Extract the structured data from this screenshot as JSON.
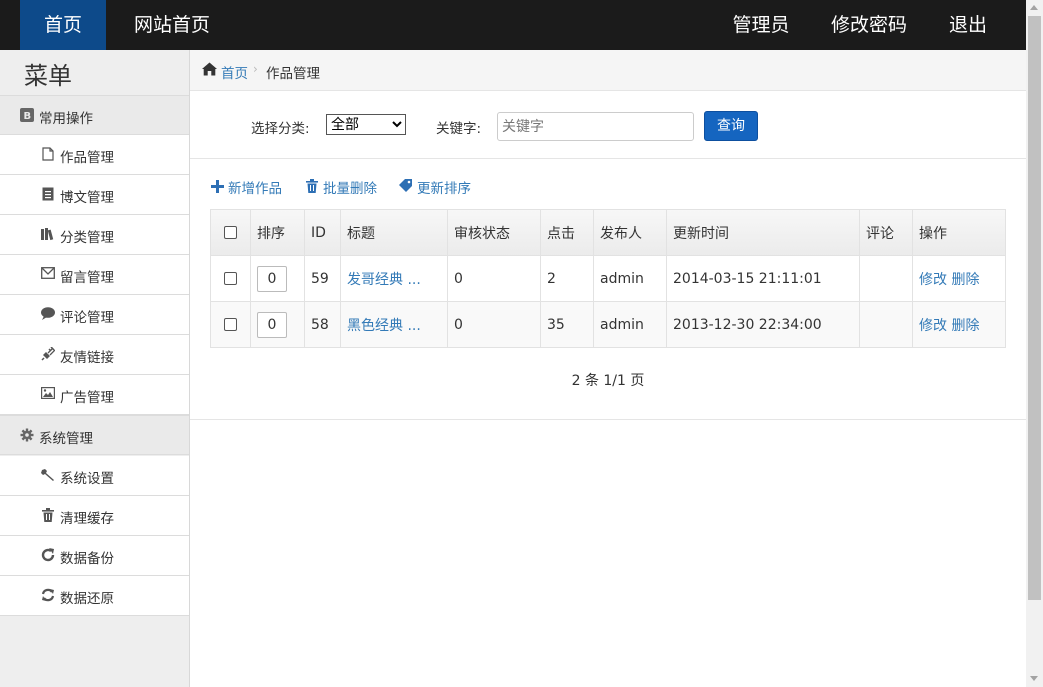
{
  "topbar": {
    "home": "首页",
    "site_home": "网站首页",
    "admin": "管理员",
    "change_password": "修改密码",
    "logout": "退出"
  },
  "sidebar": {
    "title": "菜单",
    "groups": [
      {
        "label": "常用操作",
        "icon": "bootstrap-icon"
      },
      {
        "label": "系统管理",
        "icon": "gear-icon"
      }
    ],
    "common_items": [
      {
        "label": "作品管理",
        "icon": "file-icon"
      },
      {
        "label": "博文管理",
        "icon": "list-doc-icon"
      },
      {
        "label": "分类管理",
        "icon": "books-icon"
      },
      {
        "label": "留言管理",
        "icon": "envelope-icon"
      },
      {
        "label": "评论管理",
        "icon": "comment-icon"
      },
      {
        "label": "友情链接",
        "icon": "plug-icon"
      },
      {
        "label": "广告管理",
        "icon": "picture-icon"
      }
    ],
    "system_items": [
      {
        "label": "系统设置",
        "icon": "wrench-icon"
      },
      {
        "label": "清理缓存",
        "icon": "trash-icon"
      },
      {
        "label": "数据备份",
        "icon": "refresh-icon"
      },
      {
        "label": "数据还原",
        "icon": "sync-icon"
      }
    ]
  },
  "breadcrumb": {
    "home": "首页",
    "current": "作品管理"
  },
  "search": {
    "category_label": "选择分类:",
    "category_selected": "全部",
    "keyword_label": "关键字:",
    "keyword_placeholder": "关键字",
    "query_button": "查询"
  },
  "toolbar": {
    "add": "新增作品",
    "batch_delete": "批量删除",
    "update_sort": "更新排序"
  },
  "table": {
    "headers": [
      "排序",
      "ID",
      "标题",
      "审核状态",
      "点击",
      "发布人",
      "更新时间",
      "评论",
      "操作"
    ],
    "rows": [
      {
        "sort": "0",
        "id": "59",
        "title": "发哥经典 ...",
        "status": "0",
        "clicks": "2",
        "author": "admin",
        "updated": "2014-03-15 21:11:01",
        "comments": "",
        "edit": "修改",
        "delete": "删除"
      },
      {
        "sort": "0",
        "id": "58",
        "title": "黑色经典 ...",
        "status": "0",
        "clicks": "35",
        "author": "admin",
        "updated": "2013-12-30 22:34:00",
        "comments": "",
        "edit": "修改",
        "delete": "删除"
      }
    ]
  },
  "pager": "2 条 1/1 页",
  "colors": {
    "topbar_bg": "#1b1b1b",
    "active_nav": "#0d4a8a",
    "link": "#337ab7",
    "button": "#1565c0"
  }
}
